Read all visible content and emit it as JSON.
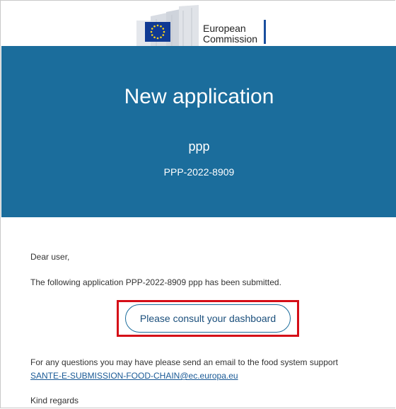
{
  "logo": {
    "line1": "European",
    "line2": "Commission",
    "icon": "eu-flag-icon"
  },
  "header": {
    "title": "New application",
    "subtitle": "ppp",
    "application_id": "PPP-2022-8909"
  },
  "message": {
    "greeting": "Dear user,",
    "submitted_text": "The following application PPP-2022-8909 ppp has been submitted.",
    "button_label": "Please consult your dashboard",
    "support_text": "For any questions you may have please send an email to the food system support",
    "support_email": "SANTE-E-SUBMISSION-FOOD-CHAIN@ec.europa.eu",
    "closing": "Kind regards"
  },
  "colors": {
    "banner": "#1b6d9c",
    "highlight": "#d50e17",
    "link": "#1a5a96"
  }
}
